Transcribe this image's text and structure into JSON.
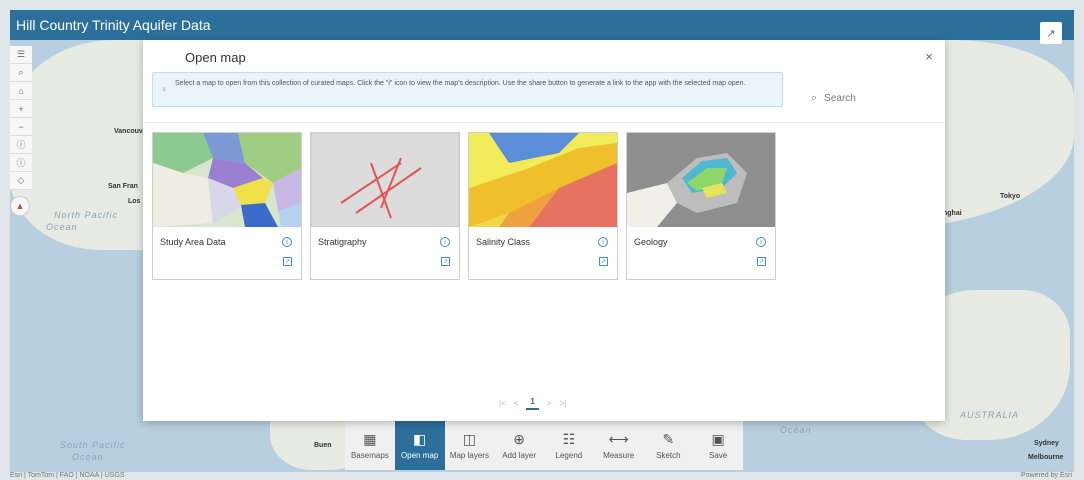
{
  "header": {
    "title": "Hill Country Trinity Aquifer Data"
  },
  "map": {
    "ocean_labels": [
      "South Pacific",
      "Ocean",
      "North Pacific",
      "Ocean",
      "AUSTRALIA",
      "Ocean"
    ],
    "cities": [
      "Vancouv",
      "San Fran",
      "Los",
      "Buen",
      "Tokyo",
      "nghai",
      "Sydney",
      "Melbourne"
    ],
    "attribution": "Esri | TomTom | FAO | NOAA | USGS",
    "powered_by": "Powered by Esri"
  },
  "modal": {
    "title": "Open map",
    "close_glyph": "×",
    "info_text": "Select a map to open from this collection of curated maps. Click the \"i\" icon to view the map's description. Use the share button to generate a link to the app with the selected map open.",
    "search_placeholder": "Search",
    "cards": [
      {
        "title": "Study Area Data"
      },
      {
        "title": "Stratigraphy"
      },
      {
        "title": "Salinity Class"
      },
      {
        "title": "Geology"
      }
    ],
    "pagination": {
      "first": "|<",
      "prev": "<",
      "current": "1",
      "next": ">",
      "last": ">|"
    }
  },
  "toolbar": {
    "items": [
      {
        "label": "Basemaps",
        "icon": "basemaps-icon",
        "active": false
      },
      {
        "label": "Open map",
        "icon": "open-map-icon",
        "active": true
      },
      {
        "label": "Map layers",
        "icon": "layers-icon",
        "active": false
      },
      {
        "label": "Add layer",
        "icon": "add-layer-icon",
        "active": false
      },
      {
        "label": "Legend",
        "icon": "legend-icon",
        "active": false
      },
      {
        "label": "Measure",
        "icon": "measure-icon",
        "active": false
      },
      {
        "label": "Sketch",
        "icon": "sketch-icon",
        "active": false
      },
      {
        "label": "Save",
        "icon": "save-icon",
        "active": false
      }
    ]
  },
  "colors": {
    "header": "#2d6f9b",
    "accent": "#3a8fc4",
    "info_bg": "#eaf4fa"
  }
}
